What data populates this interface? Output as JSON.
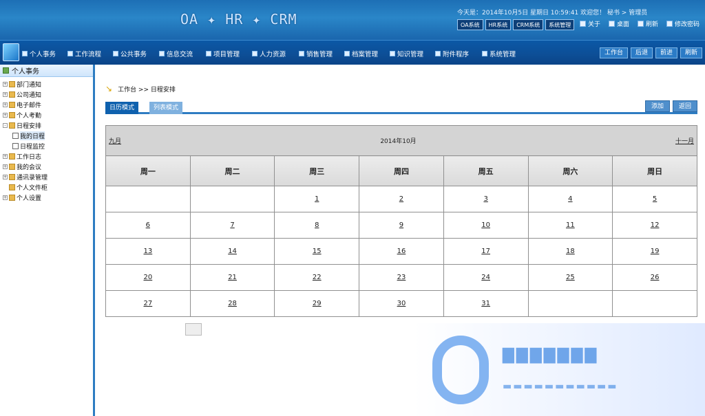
{
  "header": {
    "brand": "OA ✦ HR ✦ CRM",
    "topinfo": "今天是：2014年10月5日  星期日  10:59:41  欢迎您！ 秘书 > 管理员",
    "systems": [
      "OA系统",
      "HR系统",
      "CRM系统",
      "系统管理"
    ],
    "links": [
      {
        "label": "关于",
        "icon": "info-icon"
      },
      {
        "label": "桌面",
        "icon": "desktop-icon"
      },
      {
        "label": "刷新",
        "icon": "refresh-icon"
      },
      {
        "label": "修改密码",
        "icon": "lock-icon"
      }
    ]
  },
  "nav": {
    "items": [
      "个人事务",
      "工作流程",
      "公共事务",
      "信息交流",
      "项目管理",
      "人力资源",
      "销售管理",
      "档案管理",
      "知识管理",
      "附件程序",
      "系统管理"
    ],
    "right": [
      "工作台",
      "后退",
      "前进",
      "刷新"
    ]
  },
  "sidebar": {
    "title": "个人事务",
    "items": [
      {
        "label": "部门通知",
        "child": false
      },
      {
        "label": "公司通知",
        "child": false
      },
      {
        "label": "电子邮件",
        "child": false
      },
      {
        "label": "个人考勤",
        "child": false
      },
      {
        "label": "日程安排",
        "child": false
      },
      {
        "label": "我的日程",
        "child": true
      },
      {
        "label": "日程监控",
        "child": true
      },
      {
        "label": "工作日志",
        "child": false
      },
      {
        "label": "我的会议",
        "child": false
      },
      {
        "label": "通讯录管理",
        "child": false
      },
      {
        "label": "个人文件柜",
        "child": false
      },
      {
        "label": "个人设置",
        "child": false
      }
    ]
  },
  "main": {
    "breadcrumb": "工作台 >> 日程安排",
    "tabs": {
      "active": "日历模式",
      "other": "列表模式"
    },
    "buttons": [
      "添加",
      "返回"
    ]
  },
  "calendar": {
    "prev": "九月",
    "title": "2014年10月",
    "next": "十一月",
    "weekdays": [
      "周一",
      "周二",
      "周三",
      "周四",
      "周五",
      "周六",
      "周日"
    ],
    "weeks": [
      [
        "",
        "",
        "1",
        "2",
        "3",
        "4",
        "5"
      ],
      [
        "6",
        "7",
        "8",
        "9",
        "10",
        "11",
        "12"
      ],
      [
        "13",
        "14",
        "15",
        "16",
        "17",
        "18",
        "19"
      ],
      [
        "20",
        "21",
        "22",
        "23",
        "24",
        "25",
        "26"
      ],
      [
        "27",
        "28",
        "29",
        "30",
        "31",
        "",
        ""
      ]
    ]
  }
}
